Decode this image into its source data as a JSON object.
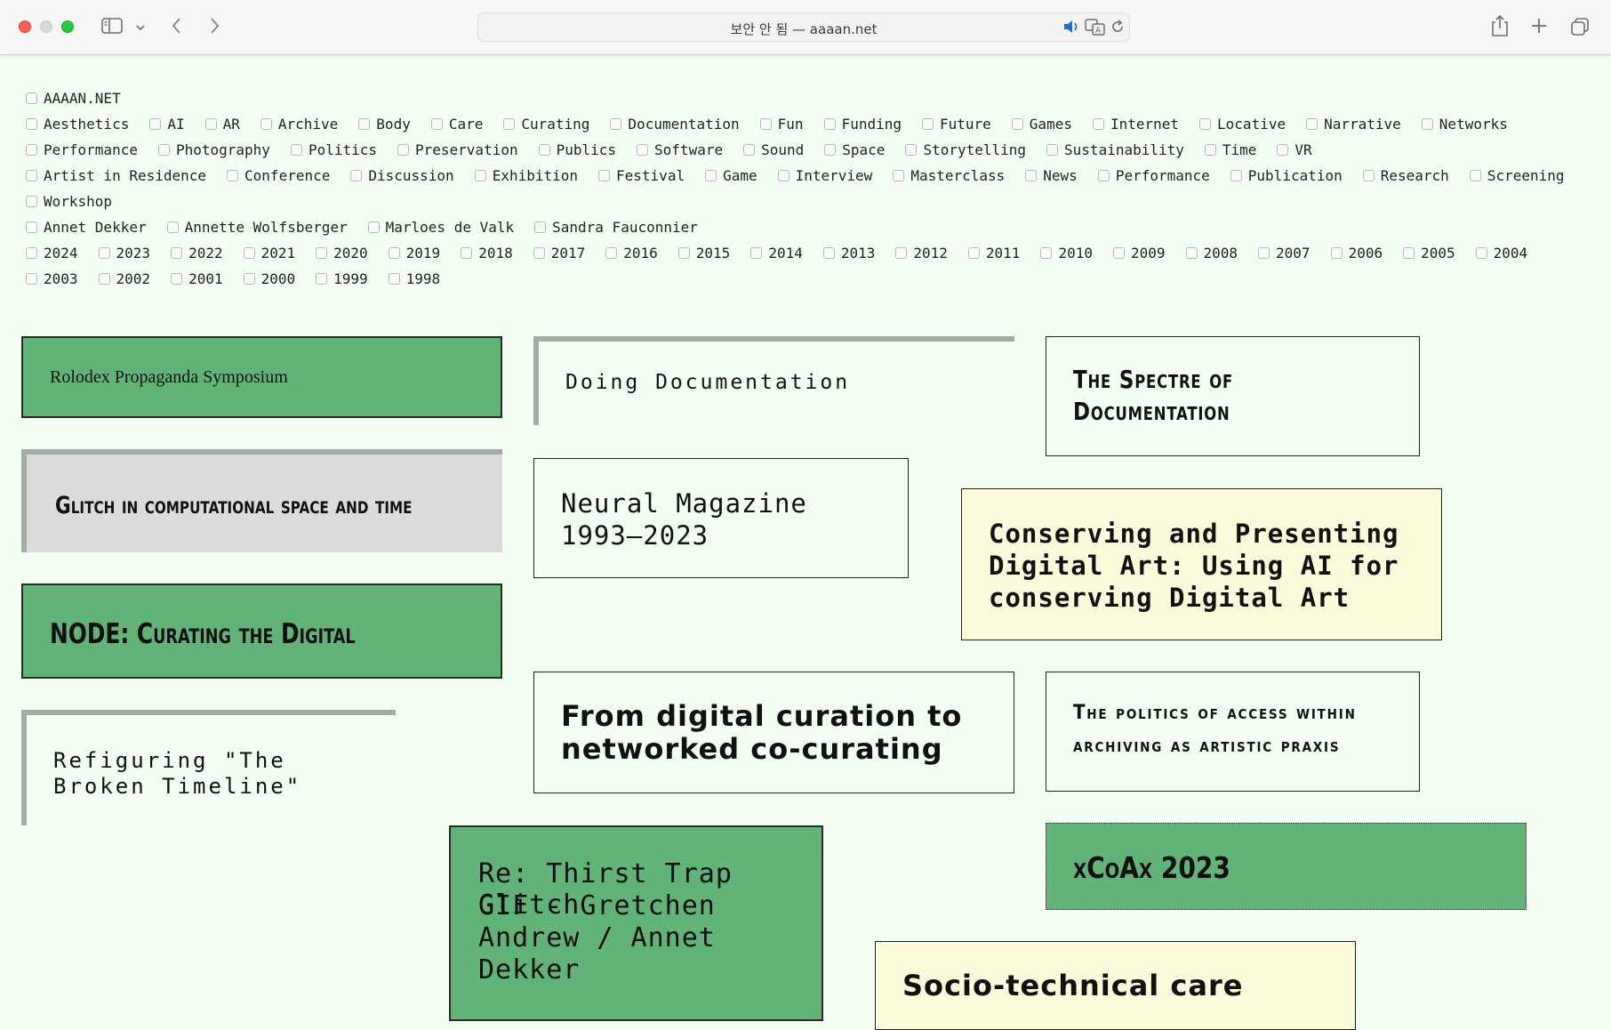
{
  "browser": {
    "address": "보안 안 됨 — aaaan.net"
  },
  "filters": {
    "rows": [
      [
        "AAAAN.NET"
      ],
      [
        "Aesthetics",
        "AI",
        "AR",
        "Archive",
        "Body",
        "Care",
        "Curating",
        "Documentation",
        "Fun",
        "Funding",
        "Future",
        "Games",
        "Internet",
        "Locative",
        "Narrative",
        "Networks"
      ],
      [
        "Performance",
        "Photography",
        "Politics",
        "Preservation",
        "Publics",
        "Software",
        "Sound",
        "Space",
        "Storytelling",
        "Sustainability",
        "Time",
        "VR"
      ],
      [
        "Artist in Residence",
        "Conference",
        "Discussion",
        "Exhibition",
        "Festival",
        "Game",
        "Interview",
        "Masterclass",
        "News",
        "Performance",
        "Publication",
        "Research",
        "Screening"
      ],
      [
        "Workshop"
      ],
      [
        "Annet Dekker",
        "Annette Wolfsberger",
        "Marloes de Valk",
        "Sandra Fauconnier"
      ],
      [
        "2024",
        "2023",
        "2022",
        "2021",
        "2020",
        "2019",
        "2018",
        "2017",
        "2016",
        "2015",
        "2014",
        "2013",
        "2012",
        "2011",
        "2010",
        "2009",
        "2008",
        "2007",
        "2006",
        "2005",
        "2004"
      ],
      [
        "2003",
        "2002",
        "2001",
        "2000",
        "1999",
        "1998"
      ]
    ]
  },
  "cards": {
    "rolodex": "Rolodex Propaganda Symposium",
    "doing_doc": "Doing Documentation",
    "spectre_1": "The Spectre of",
    "spectre_2": "Documentation",
    "glitch": "Glitch in computational space and time",
    "neural_1": "Neural Magazine",
    "neural_2": "1993–2023",
    "conserving_1": "Conserving and Presenting",
    "conserving_2": "Digital Art: Using AI for",
    "conserving_3": "conserving Digital Art",
    "node": "NODE: Curating the Digital",
    "from_digital_1": "From digital curation to",
    "from_digital_2": "networked co-curating",
    "politics_1": "The politics of access within",
    "politics_2": "archiving as artistic praxis",
    "refiguring_1": "Refiguring \"The",
    "refiguring_2": "Broken Timeline\"",
    "rethirst_1": "Re: Thirst Trap Glitch",
    "rethirst_2": "GIF - Gretchen",
    "rethirst_3": "Andrew / Annet",
    "rethirst_4": "Dekker",
    "xcoax": "xCoAx 2023",
    "socio": "Socio-technical care"
  }
}
